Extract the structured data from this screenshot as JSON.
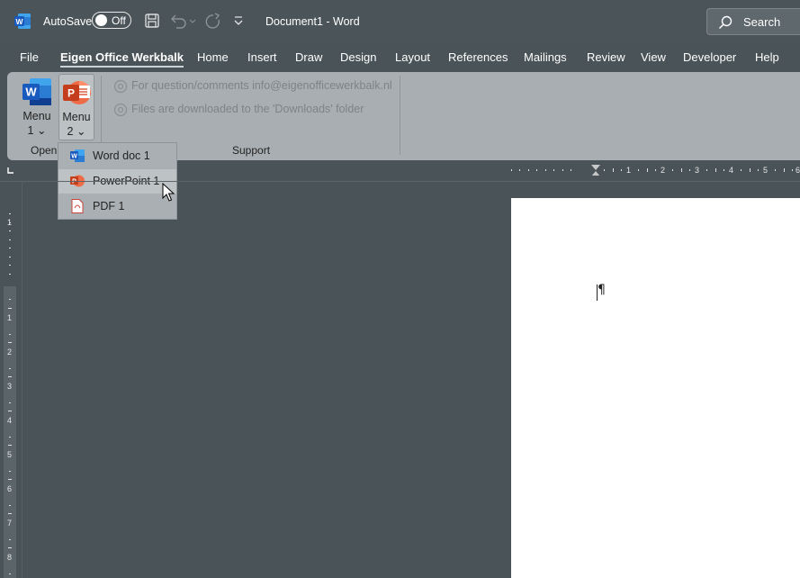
{
  "titlebar": {
    "autosave_label": "AutoSave",
    "toggle_state": "Off",
    "document_title": "Document1  -  Word",
    "search_placeholder": "Search"
  },
  "tabs": [
    {
      "label": "File"
    },
    {
      "label": "Eigen Office Werkbalk",
      "active": true
    },
    {
      "label": "Home"
    },
    {
      "label": "Insert"
    },
    {
      "label": "Draw"
    },
    {
      "label": "Design"
    },
    {
      "label": "Layout"
    },
    {
      "label": "References"
    },
    {
      "label": "Mailings"
    },
    {
      "label": "Review"
    },
    {
      "label": "View"
    },
    {
      "label": "Developer"
    },
    {
      "label": "Help"
    }
  ],
  "ribbon": {
    "menu1": {
      "line1": "Menu",
      "line2": "1"
    },
    "menu2": {
      "line1": "Menu",
      "line2": "2"
    },
    "group_open": "Open",
    "group_support": "Support",
    "support_lines": [
      "For question/comments info@eigenofficewerkbalk.nl",
      "Files are downloaded to the 'Downloads' folder"
    ]
  },
  "dropdown": {
    "items": [
      {
        "label": "Word doc 1",
        "icon": "word-doc-icon"
      },
      {
        "label": "PowerPoint 1",
        "icon": "powerpoint-icon"
      },
      {
        "label": "PDF 1",
        "icon": "pdf-icon"
      }
    ]
  },
  "ruler": {
    "h_numbers": [
      "1",
      "2",
      "3",
      "4",
      "5",
      "6"
    ],
    "v_numbers": [
      "1",
      "1",
      "2",
      "3",
      "4",
      "5",
      "6",
      "7",
      "8"
    ]
  },
  "colors": {
    "background": "#4a5458",
    "ribbon": "#a8aeb1",
    "word_blue": "#2b579a",
    "powerpoint_orange": "#d24726"
  }
}
